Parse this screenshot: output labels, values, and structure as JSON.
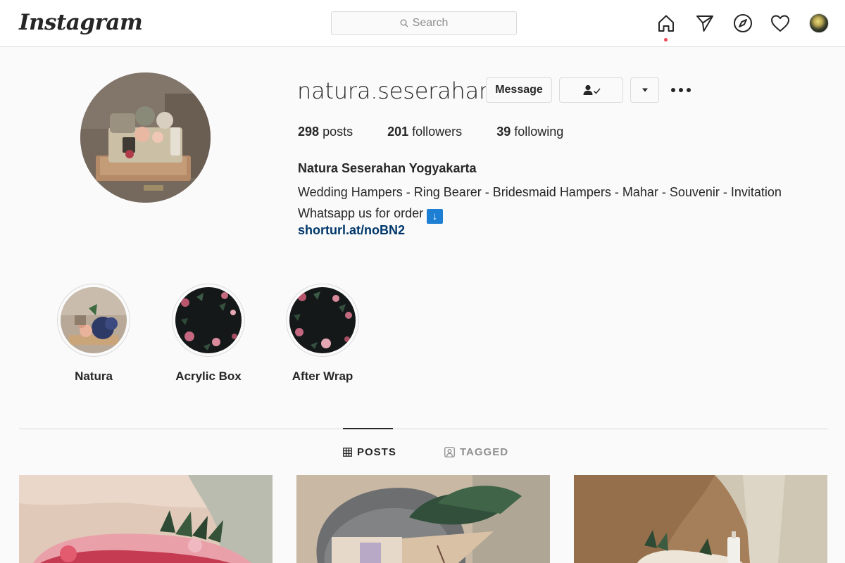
{
  "app": {
    "logo": "Instagram"
  },
  "search": {
    "placeholder": "Search"
  },
  "nav": {
    "icons": [
      "home-icon",
      "direct-icon",
      "explore-icon",
      "activity-icon",
      "profile-avatar"
    ]
  },
  "profile": {
    "username": "natura.seserahan",
    "buttons": {
      "message": "Message"
    },
    "stats": {
      "posts_count": "298",
      "posts_label": "posts",
      "followers_count": "201",
      "followers_label": "followers",
      "following_count": "39",
      "following_label": "following"
    },
    "full_name": "Natura Seserahan Yogyakarta",
    "bio_line1": "Wedding Hampers - Ring Bearer - Bridesmaid Hampers - Mahar - Souvenir - Invitation",
    "bio_line2": "Whatsapp us for order",
    "bio_emoji": "↓",
    "link": "shorturl.at/noBN2"
  },
  "highlights": [
    {
      "label": "Natura"
    },
    {
      "label": "Acrylic Box"
    },
    {
      "label": "After Wrap"
    }
  ],
  "tabs": {
    "posts": "POSTS",
    "tagged": "TAGGED"
  },
  "colors": {
    "link": "#00376b",
    "accent_dot": "#ed4956",
    "border": "#dbdbdb"
  }
}
